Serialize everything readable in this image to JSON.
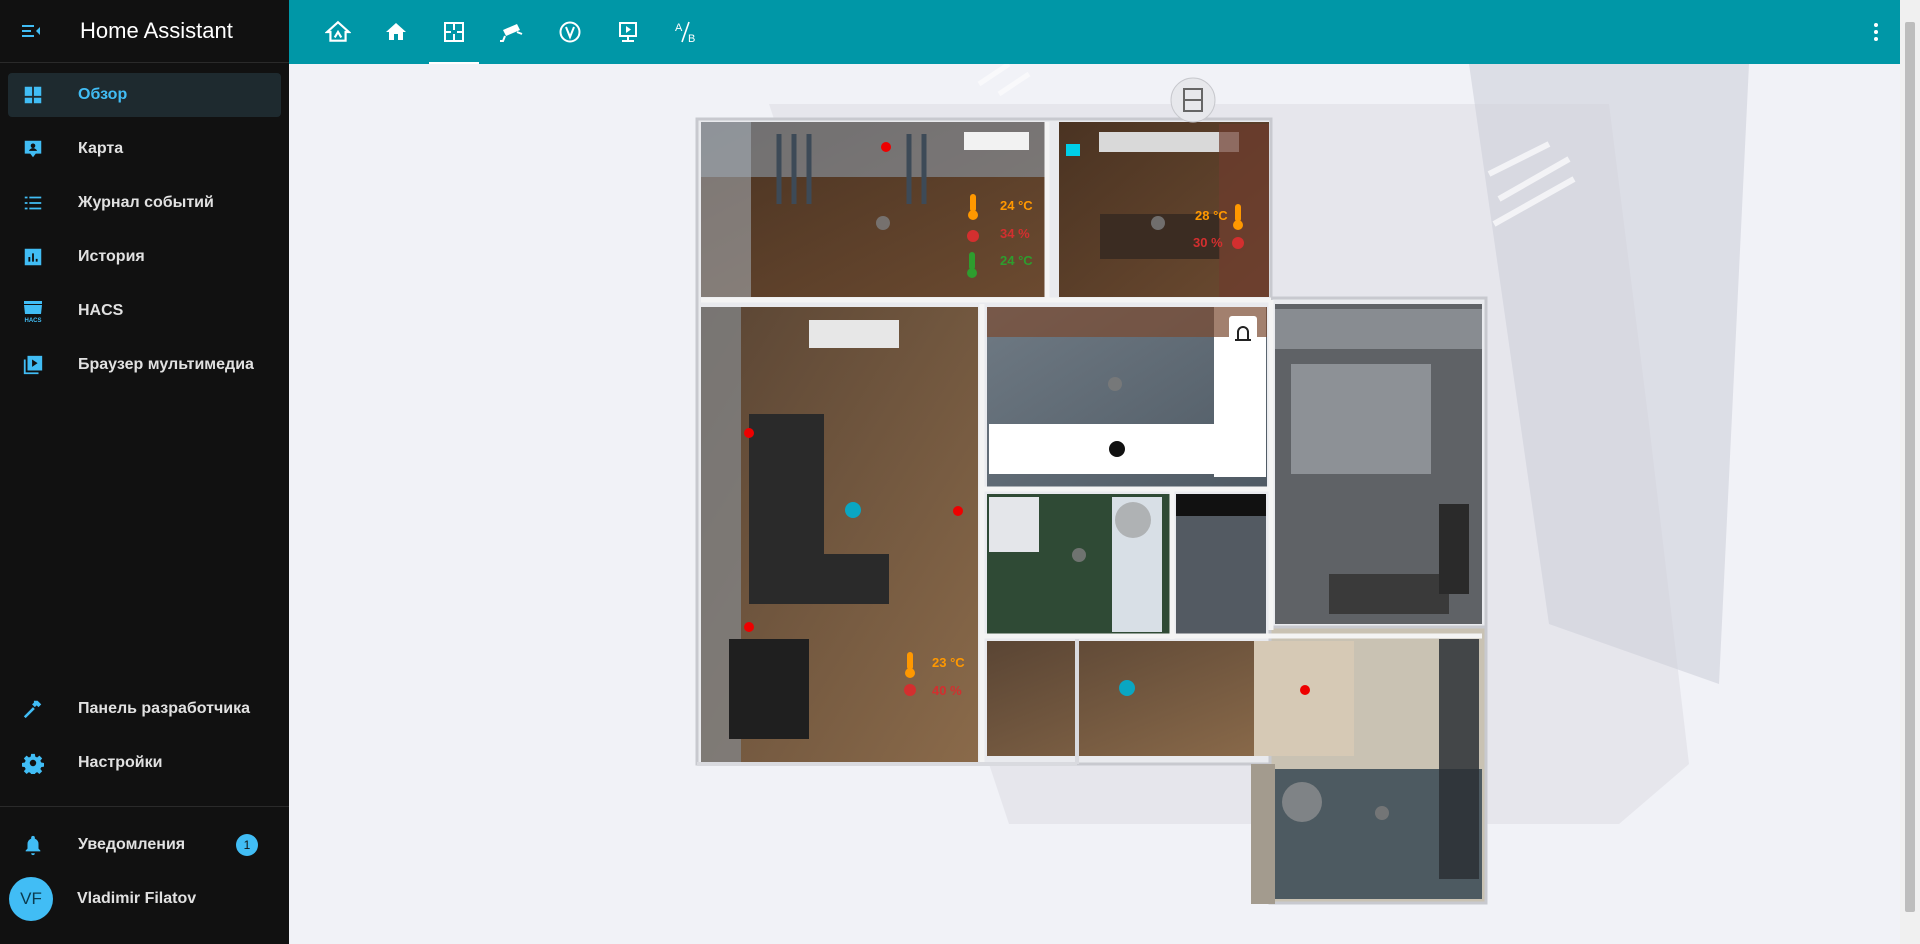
{
  "app": {
    "title": "Home Assistant"
  },
  "sidebar": {
    "items": [
      {
        "label": "Обзор",
        "icon": "dashboard-icon",
        "active": true
      },
      {
        "label": "Карта",
        "icon": "map-account-icon"
      },
      {
        "label": "Журнал событий",
        "icon": "logbook-icon"
      },
      {
        "label": "История",
        "icon": "history-chart-icon"
      },
      {
        "label": "HACS",
        "icon": "hacs-store-icon"
      },
      {
        "label": "Браузер мультимедиа",
        "icon": "media-play-box-icon"
      }
    ],
    "bottom_items": [
      {
        "label": "Панель разработчика",
        "icon": "hammer-icon"
      },
      {
        "label": "Настройки",
        "icon": "gear-icon"
      }
    ],
    "notifications": {
      "label": "Уведомления",
      "count": "1"
    },
    "user": {
      "initials": "VF",
      "name": "Vladimir Filatov"
    }
  },
  "topbar": {
    "tabs": [
      {
        "icon": "home-automation-icon"
      },
      {
        "icon": "home-icon"
      },
      {
        "icon": "floor-plan-icon",
        "active": true
      },
      {
        "icon": "cctv-camera-icon"
      },
      {
        "icon": "vacuum-v-icon"
      },
      {
        "icon": "tv-play-icon"
      },
      {
        "icon": "ab-testing-icon"
      }
    ]
  },
  "floorplan": {
    "sensors": {
      "bedroom_top_temp": "24 °C",
      "bedroom_top_humidity": "34 %",
      "bedroom_top_target": "24 °C",
      "kitchen_temp": "28 °C",
      "kitchen_humidity": "30 %",
      "living_temp": "23 °C",
      "living_humidity": "40 %"
    }
  },
  "colors": {
    "sidebar_bg": "#111111",
    "topbar_bg": "#0097a7",
    "accent": "#41bdf5",
    "content_bg": "#f1f2f7",
    "warm": "#ff9800",
    "humidity": "#d32f2f",
    "target": "#2e9d2e"
  }
}
